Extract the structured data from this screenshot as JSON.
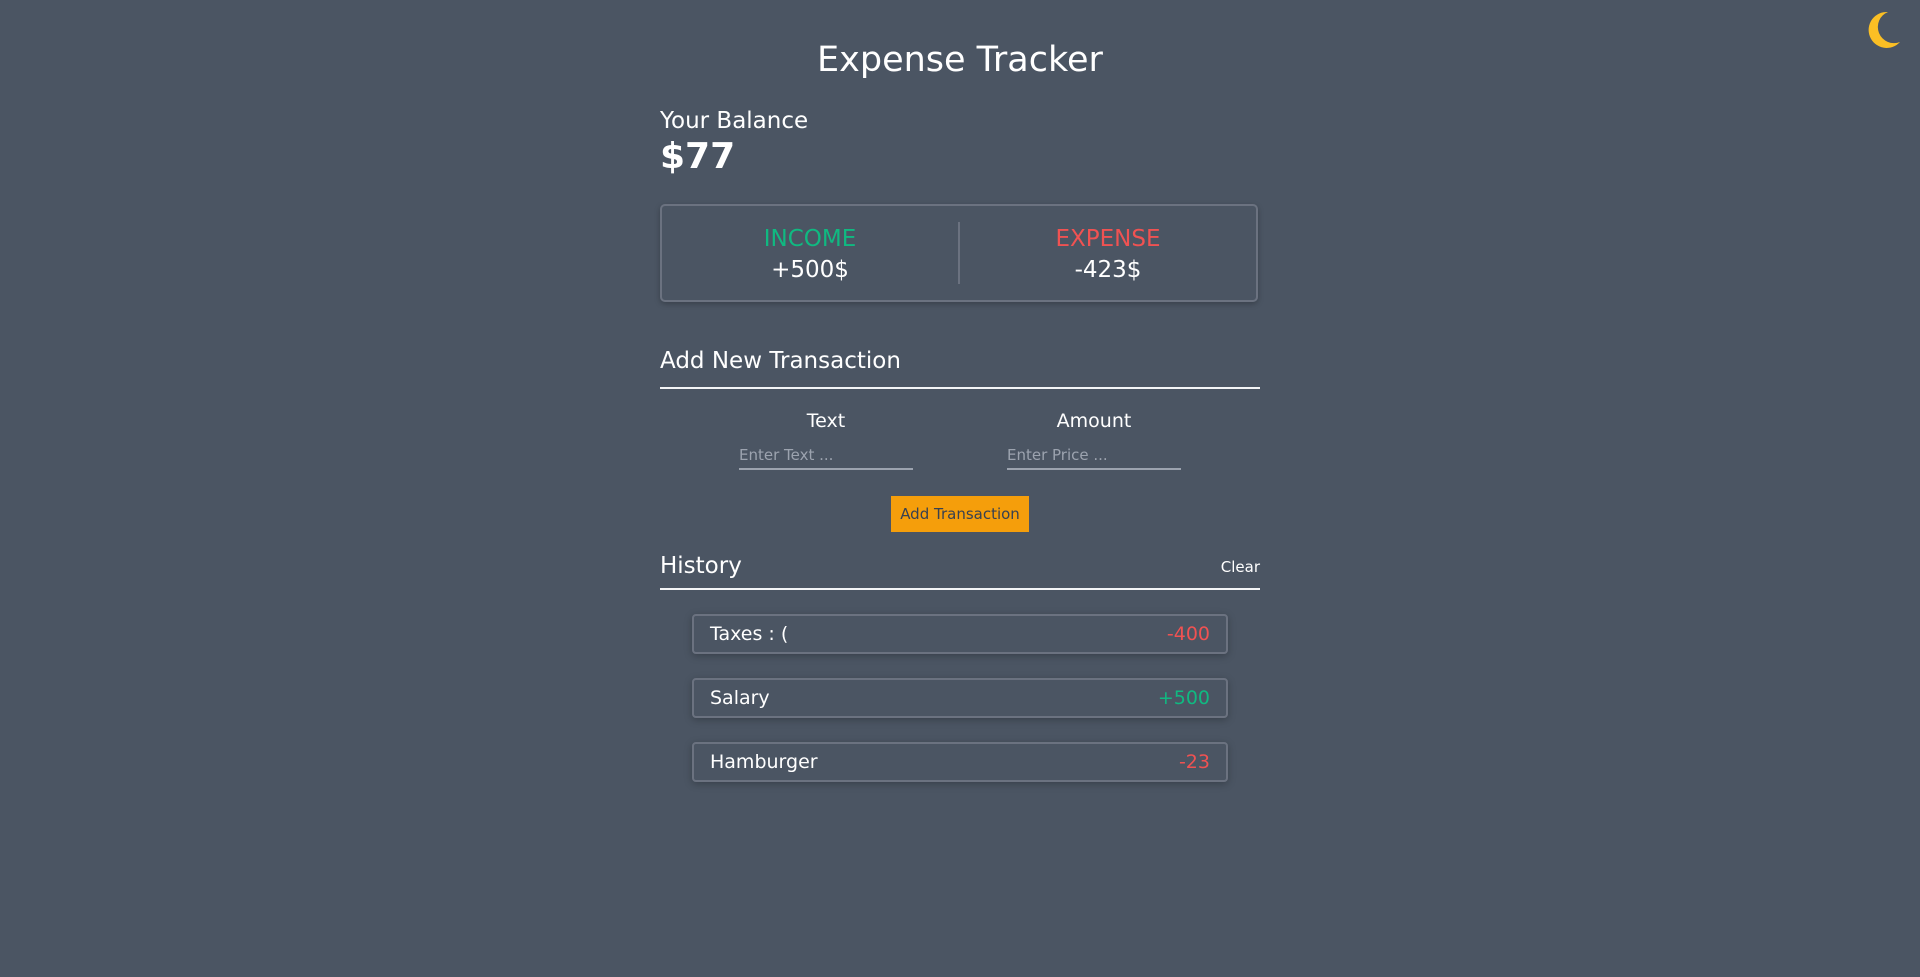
{
  "app": {
    "title": "Expense Tracker"
  },
  "theme_toggle": {
    "icon": "moon-icon",
    "color": "#fbbf24"
  },
  "balance": {
    "label": "Your Balance",
    "value": "$77"
  },
  "summary": {
    "income_label": "INCOME",
    "income_value": "+500$",
    "expense_label": "EXPENSE",
    "expense_value": "-423$"
  },
  "add_transaction": {
    "heading": "Add New Transaction",
    "text_label": "Text",
    "text_placeholder": "Enter Text ...",
    "amount_label": "Amount",
    "amount_placeholder": "Enter Price ...",
    "button_label": "Add Transaction"
  },
  "history": {
    "heading": "History",
    "clear_label": "Clear",
    "items": [
      {
        "text": "Taxes : (",
        "amount": "-400",
        "type": "expense"
      },
      {
        "text": "Salary",
        "amount": "+500",
        "type": "income"
      },
      {
        "text": "Hamburger",
        "amount": "-23",
        "type": "expense"
      }
    ]
  },
  "colors": {
    "background": "#4b5563",
    "income": "#10b981",
    "expense": "#f05252",
    "accent": "#f59e0b"
  }
}
